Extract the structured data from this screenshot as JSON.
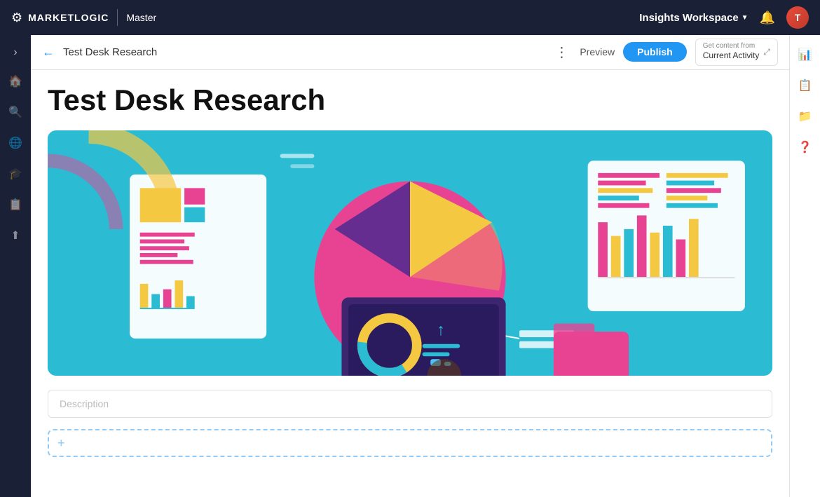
{
  "topNav": {
    "logoText": "MARKETLOGIC",
    "dividerLabel": "Master",
    "workspaceLabel": "Insights Workspace",
    "notifIcon": "🔔",
    "avatarInitial": "T"
  },
  "leftSidebar": {
    "toggleIcon": "›",
    "icons": [
      "🏠",
      "🔍",
      "🌐",
      "🎓",
      "📋",
      "⬆"
    ]
  },
  "subHeader": {
    "backIcon": "←",
    "pageTitle": "Test Desk Research",
    "moreIcon": "⋮",
    "previewLabel": "Preview",
    "publishLabel": "Publish",
    "currentActivityTopLabel": "Get content from",
    "currentActivityLabel": "Current Activity",
    "expandIcon": "⤢"
  },
  "pageContent": {
    "heading": "Test Desk Research",
    "descriptionPlaceholder": "Description"
  },
  "rightSidebar": {
    "icons": [
      "📊",
      "📋",
      "📁",
      "❓"
    ]
  }
}
